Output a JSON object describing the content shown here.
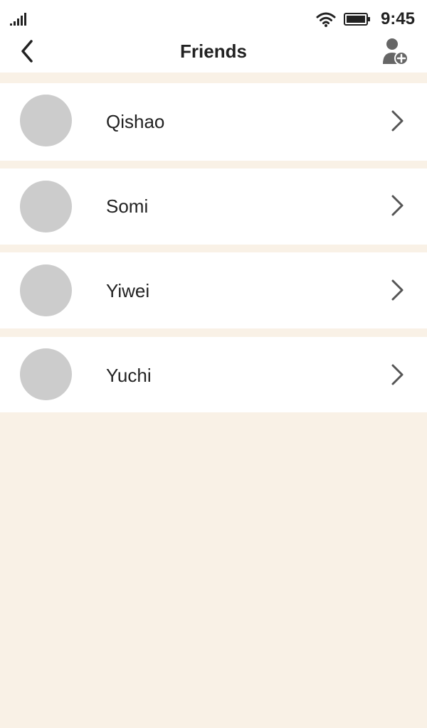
{
  "status_bar": {
    "time": "9:45",
    "signal_icon": "signal-icon",
    "wifi_icon": "wifi-icon",
    "battery_icon": "battery-icon"
  },
  "header": {
    "title": "Friends",
    "back_icon": "chevron-left-icon",
    "add_friend_icon": "add-user-icon"
  },
  "friends": [
    {
      "name": "Qishao"
    },
    {
      "name": "Somi"
    },
    {
      "name": "Yiwei"
    },
    {
      "name": "Yuchi"
    }
  ],
  "colors": {
    "page_background": "#f9f1e6",
    "row_background": "#ffffff",
    "avatar_placeholder": "#cccccc",
    "text": "#222222",
    "icon_gray": "#666666"
  }
}
